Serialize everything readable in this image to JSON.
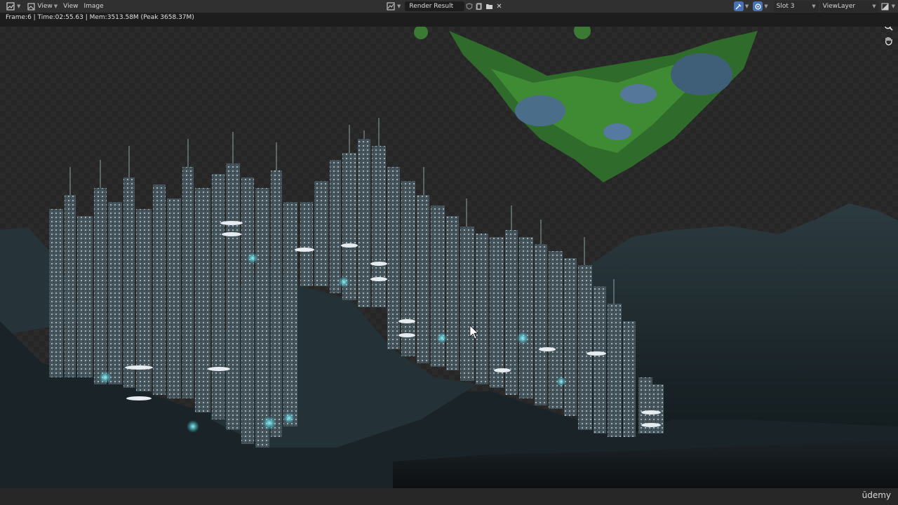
{
  "header": {
    "editor_type_icon": "image-editor-icon",
    "menu": [
      "View",
      "View",
      "Image"
    ],
    "image_name": "Render Result",
    "slot": "Slot 3",
    "view_layer": "ViewLayer"
  },
  "status": {
    "text": "Frame:6 | Time:02:55.63 | Mem:3513.58M (Peak 3658.37M)"
  },
  "viewport": {
    "icons": [
      "zoom-icon",
      "pan-hand-icon"
    ]
  },
  "footer": {
    "watermark": "ūdemy"
  }
}
